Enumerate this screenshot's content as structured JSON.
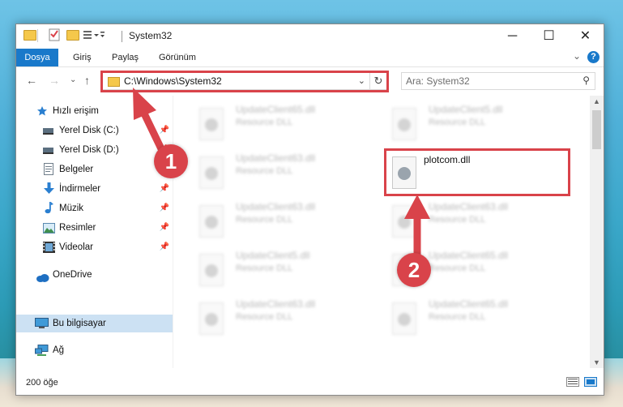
{
  "window": {
    "title": "System32",
    "controls": {
      "minimize": "─",
      "maximize": "☐",
      "close": "✕"
    }
  },
  "ribbon": {
    "tabs": [
      {
        "label": "Dosya"
      },
      {
        "label": "Giriş"
      },
      {
        "label": "Paylaş"
      },
      {
        "label": "Görünüm"
      }
    ],
    "help": "?",
    "chevron": "⌄"
  },
  "nav": {
    "back": "←",
    "forward": "→",
    "recent": "⌄",
    "up": "↑",
    "address": "C:\\Windows\\System32",
    "address_chevron": "⌄",
    "refresh": "↻",
    "search_placeholder": "Ara: System32",
    "search_icon": "⚲"
  },
  "sidebar": {
    "items": [
      {
        "label": "Hızlı erişim",
        "icon": "star-icon",
        "pinned": false
      },
      {
        "label": "Yerel Disk (C:)",
        "icon": "drive-icon",
        "pinned": true
      },
      {
        "label": "Yerel Disk (D:)",
        "icon": "drive-icon",
        "pinned": true
      },
      {
        "label": "Belgeler",
        "icon": "documents-icon",
        "pinned": true
      },
      {
        "label": "İndirmeler",
        "icon": "download-icon",
        "pinned": true
      },
      {
        "label": "Müzik",
        "icon": "music-icon",
        "pinned": true
      },
      {
        "label": "Resimler",
        "icon": "pictures-icon",
        "pinned": true
      },
      {
        "label": "Videolar",
        "icon": "video-icon",
        "pinned": true
      },
      {
        "label": "OneDrive",
        "icon": "cloud-icon",
        "pinned": false
      },
      {
        "label": "Bu bilgisayar",
        "icon": "computer-icon",
        "pinned": false,
        "selected": true
      },
      {
        "label": "Ağ",
        "icon": "network-icon",
        "pinned": false
      }
    ],
    "pin_glyph": "📌"
  },
  "files": [
    {
      "name": "UpdateClient65.dll",
      "type": "Resource DLL"
    },
    {
      "name": "UpdateClient5.dll",
      "type": "Resource DLL"
    },
    {
      "name": "UpdateClient63.dll",
      "type": "Resource DLL"
    },
    {
      "name": "plotcom.dll",
      "type": ""
    },
    {
      "name": "UpdateClient63.dll",
      "type": "Resource DLL"
    },
    {
      "name": "UpdateClient63.dll",
      "type": "Resource DLL"
    },
    {
      "name": "UpdateClient5.dll",
      "type": "Resource DLL"
    },
    {
      "name": "UpdateClient65.dll",
      "type": "Resource DLL"
    },
    {
      "name": "UpdateClient63.dll",
      "type": "Resource DLL"
    },
    {
      "name": "UpdateClient65.dll",
      "type": "Resource DLL"
    }
  ],
  "status": {
    "item_count": "200 öğe"
  },
  "annotations": {
    "step1": "1",
    "step2": "2",
    "highlight_color": "#d9434a"
  },
  "colors": {
    "accent": "#1979ca",
    "selected": "#cce1f3"
  }
}
